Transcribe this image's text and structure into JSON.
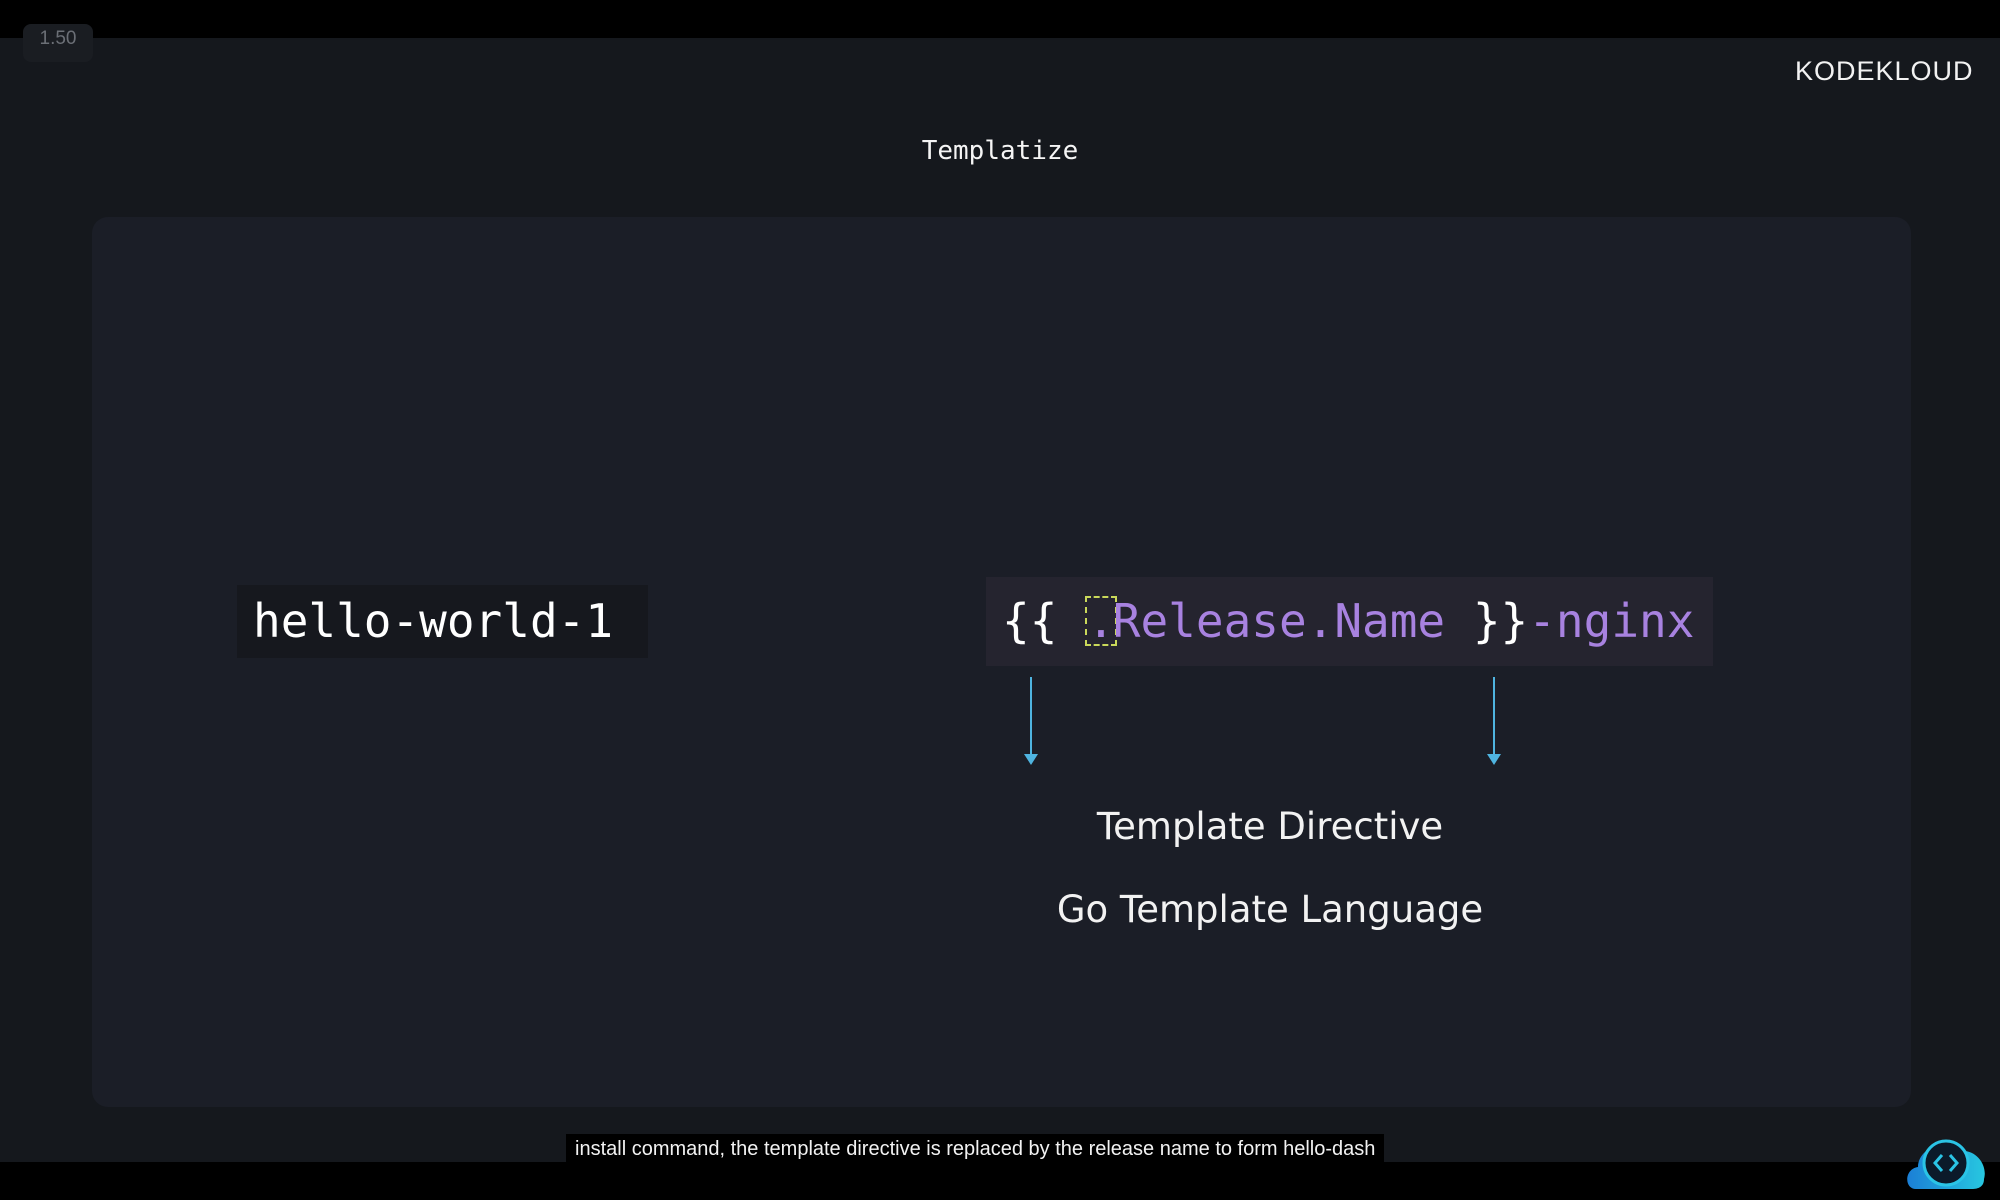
{
  "player": {
    "speed": "1.50",
    "caption": "install command, the template directive is replaced by the release name to form hello-dash"
  },
  "logo": "KODEKLOUD",
  "slide": {
    "title": "Templatize",
    "example": "hello-world-1",
    "template": {
      "open": "{{ ",
      "dot": ".",
      "field": "Release.Name",
      "close": " }}",
      "suffix": "-nginx"
    },
    "labels": [
      "Template Directive",
      "Go Template Language"
    ]
  },
  "colors": {
    "accent_purple": "#a882e0",
    "arrow": "#4fb4e0",
    "highlight": "#c9d85a"
  },
  "icons": {
    "assistant": "code-cloud-icon"
  }
}
